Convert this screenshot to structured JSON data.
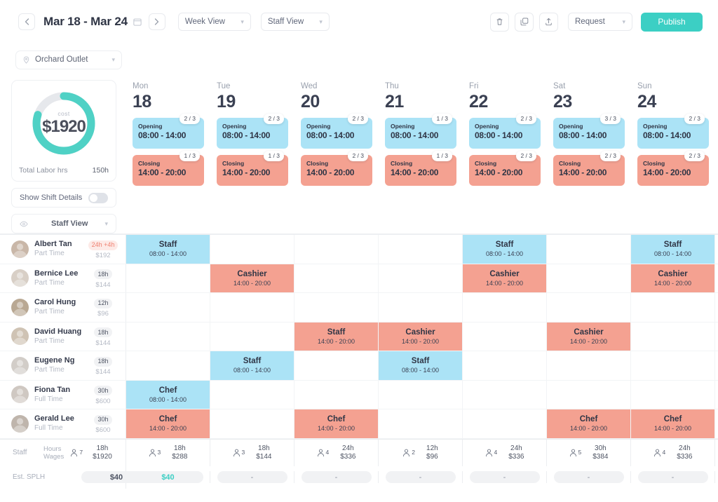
{
  "topbar": {
    "prev_label": "‹",
    "next_label": "›",
    "date_range": "Mar 18 - Mar 24",
    "calendar_icon": "calendar-icon",
    "week_view": "Week View",
    "staff_view": "Staff View",
    "delete_icon": "trash-icon",
    "duplicate_icon": "copy-icon",
    "export_icon": "upload-icon",
    "request": "Request",
    "publish": "Publish"
  },
  "outlet": {
    "name": "Orchard Outlet",
    "pin_icon": "location-pin-icon"
  },
  "cost_card": {
    "donut_label": "cost",
    "donut_value": "$1920",
    "donut_percent": 80,
    "donut_color": "#4fd1c5",
    "donut_track": "#e6e8ec",
    "labor_key": "Total Labor hrs",
    "labor_value": "150h"
  },
  "panel": {
    "show_shift_details": "Show Shift Details",
    "toggle_on": false,
    "staff_view": "Staff View",
    "eye_icon": "eye-icon"
  },
  "days": [
    {
      "name": "Mon",
      "num": "18"
    },
    {
      "name": "Tue",
      "num": "19"
    },
    {
      "name": "Wed",
      "num": "20"
    },
    {
      "name": "Thu",
      "num": "21"
    },
    {
      "name": "Fri",
      "num": "22"
    },
    {
      "name": "Sat",
      "num": "23"
    },
    {
      "name": "Sun",
      "num": "24"
    }
  ],
  "templates": {
    "opening": {
      "title": "Opening",
      "time": "08:00 - 14:00",
      "counts": [
        "2 / 3",
        "2 / 3",
        "2 / 3",
        "1 / 3",
        "2 / 3",
        "3 / 3",
        "2 / 3"
      ]
    },
    "closing": {
      "title": "Closing",
      "time": "14:00 - 20:00",
      "counts": [
        "1 / 3",
        "1 / 3",
        "2 / 3",
        "1 / 3",
        "2 / 3",
        "2 / 3",
        "2 / 3"
      ]
    }
  },
  "staff": [
    {
      "name": "Albert Tan",
      "type": "Part Time",
      "hours": "24h +4h",
      "overtime": true,
      "wage": "$192",
      "shifts": [
        {
          "role": "Staff",
          "time": "08:00 - 14:00",
          "kind": "open"
        },
        null,
        null,
        null,
        {
          "role": "Staff",
          "time": "08:00 - 14:00",
          "kind": "open"
        },
        null,
        {
          "role": "Staff",
          "time": "08:00 - 14:00",
          "kind": "open"
        }
      ]
    },
    {
      "name": "Bernice Lee",
      "type": "Part Time",
      "hours": "18h",
      "overtime": false,
      "wage": "$144",
      "shifts": [
        null,
        {
          "role": "Cashier",
          "time": "14:00 - 20:00",
          "kind": "close"
        },
        null,
        null,
        {
          "role": "Cashier",
          "time": "14:00 - 20:00",
          "kind": "close"
        },
        null,
        {
          "role": "Cashier",
          "time": "14:00 - 20:00",
          "kind": "close"
        }
      ]
    },
    {
      "name": "Carol Hung",
      "type": "Part Time",
      "hours": "12h",
      "overtime": false,
      "wage": "$96",
      "shifts": [
        null,
        null,
        null,
        null,
        null,
        null,
        null
      ]
    },
    {
      "name": "David Huang",
      "type": "Part Time",
      "hours": "18h",
      "overtime": false,
      "wage": "$144",
      "shifts": [
        null,
        null,
        {
          "role": "Staff",
          "time": "14:00 - 20:00",
          "kind": "close"
        },
        {
          "role": "Cashier",
          "time": "14:00 - 20:00",
          "kind": "close"
        },
        null,
        {
          "role": "Cashier",
          "time": "14:00 - 20:00",
          "kind": "close"
        },
        null
      ]
    },
    {
      "name": "Eugene Ng",
      "type": "Part Time",
      "hours": "18h",
      "overtime": false,
      "wage": "$144",
      "shifts": [
        null,
        {
          "role": "Staff",
          "time": "08:00 - 14:00",
          "kind": "open"
        },
        null,
        {
          "role": "Staff",
          "time": "08:00 - 14:00",
          "kind": "open"
        },
        null,
        null,
        null
      ]
    },
    {
      "name": "Fiona Tan",
      "type": "Full Time",
      "hours": "30h",
      "overtime": false,
      "wage": "$600",
      "shifts": [
        {
          "role": "Chef",
          "time": "08:00 - 14:00",
          "kind": "open"
        },
        null,
        null,
        null,
        null,
        null,
        null
      ]
    },
    {
      "name": "Gerald Lee",
      "type": "Full Time",
      "hours": "30h",
      "overtime": false,
      "wage": "$600",
      "shifts": [
        {
          "role": "Chef",
          "time": "14:00 - 20:00",
          "kind": "close"
        },
        null,
        {
          "role": "Chef",
          "time": "14:00 - 20:00",
          "kind": "close"
        },
        null,
        null,
        {
          "role": "Chef",
          "time": "14:00 - 20:00",
          "kind": "close"
        },
        {
          "role": "Chef",
          "time": "14:00 - 20:00",
          "kind": "close"
        }
      ]
    }
  ],
  "footer": {
    "label_staff": "Staff",
    "label_hours": "Hours",
    "label_wages": "Wages",
    "person_icon": "person-icon",
    "total": {
      "count": "7",
      "hours": "18h",
      "wages": "$1920"
    },
    "daily": [
      {
        "count": "3",
        "hours": "18h",
        "wages": "$288"
      },
      {
        "count": "3",
        "hours": "18h",
        "wages": "$144"
      },
      {
        "count": "4",
        "hours": "24h",
        "wages": "$336"
      },
      {
        "count": "2",
        "hours": "12h",
        "wages": "$96"
      },
      {
        "count": "4",
        "hours": "24h",
        "wages": "$336"
      },
      {
        "count": "5",
        "hours": "30h",
        "wages": "$384"
      },
      {
        "count": "4",
        "hours": "24h",
        "wages": "$336"
      }
    ],
    "splh_label": "Est. SPLH",
    "splh_total": "$40",
    "splh_daily": [
      "$40",
      "-",
      "-",
      "-",
      "-",
      "-",
      "-"
    ]
  }
}
